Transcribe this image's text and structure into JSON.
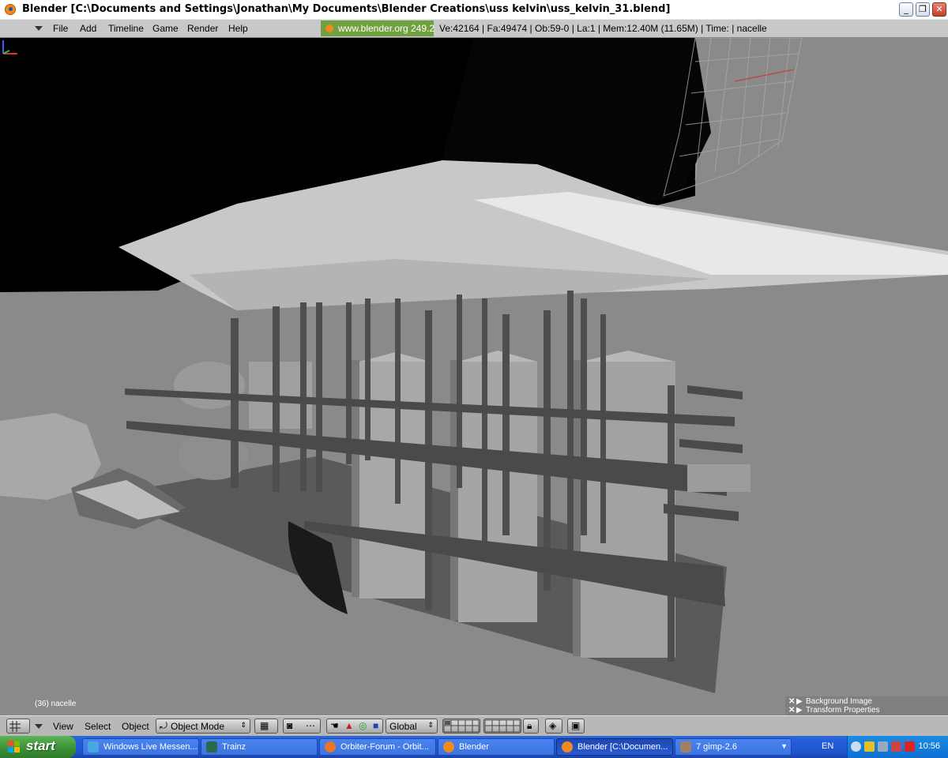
{
  "window": {
    "title": "Blender [C:\\Documents and Settings\\Jonathan\\My Documents\\Blender Creations\\uss kelvin\\uss_kelvin_31.blend]",
    "buttons": [
      "_",
      "❐",
      "✕"
    ]
  },
  "top_header": {
    "menu": [
      "File",
      "Add",
      "Timeline",
      "Game",
      "Render",
      "Help"
    ],
    "website_label": "www.blender.org 249.2",
    "stats": "Ve:42164 | Fa:49474 | Ob:59-0 | La:1  | Mem:12.40M (11.65M)  | Time: | nacelle"
  },
  "viewport": {
    "frame_label": "(36) nacelle",
    "panels": [
      "Background Image",
      "Transform Properties"
    ]
  },
  "view_header": {
    "menu": [
      "View",
      "Select",
      "Object"
    ],
    "mode": "Object Mode",
    "orientation": "Global"
  },
  "taskbar": {
    "start_label": "start",
    "items": [
      {
        "label": "Windows Live Messen...",
        "color": "#4aa8e0"
      },
      {
        "label": "Trainz",
        "color": "#2a6a4a"
      },
      {
        "label": "Orbiter-Forum - Orbit...",
        "color": "#e8762a"
      },
      {
        "label": "Blender",
        "color": "#f08a1c"
      },
      {
        "label": "Blender [C:\\Documen...",
        "color": "#f08a1c",
        "active": true
      },
      {
        "label": "7 gimp-2.6",
        "color": "#a08060"
      }
    ],
    "language": "EN",
    "clock": "10:56"
  }
}
